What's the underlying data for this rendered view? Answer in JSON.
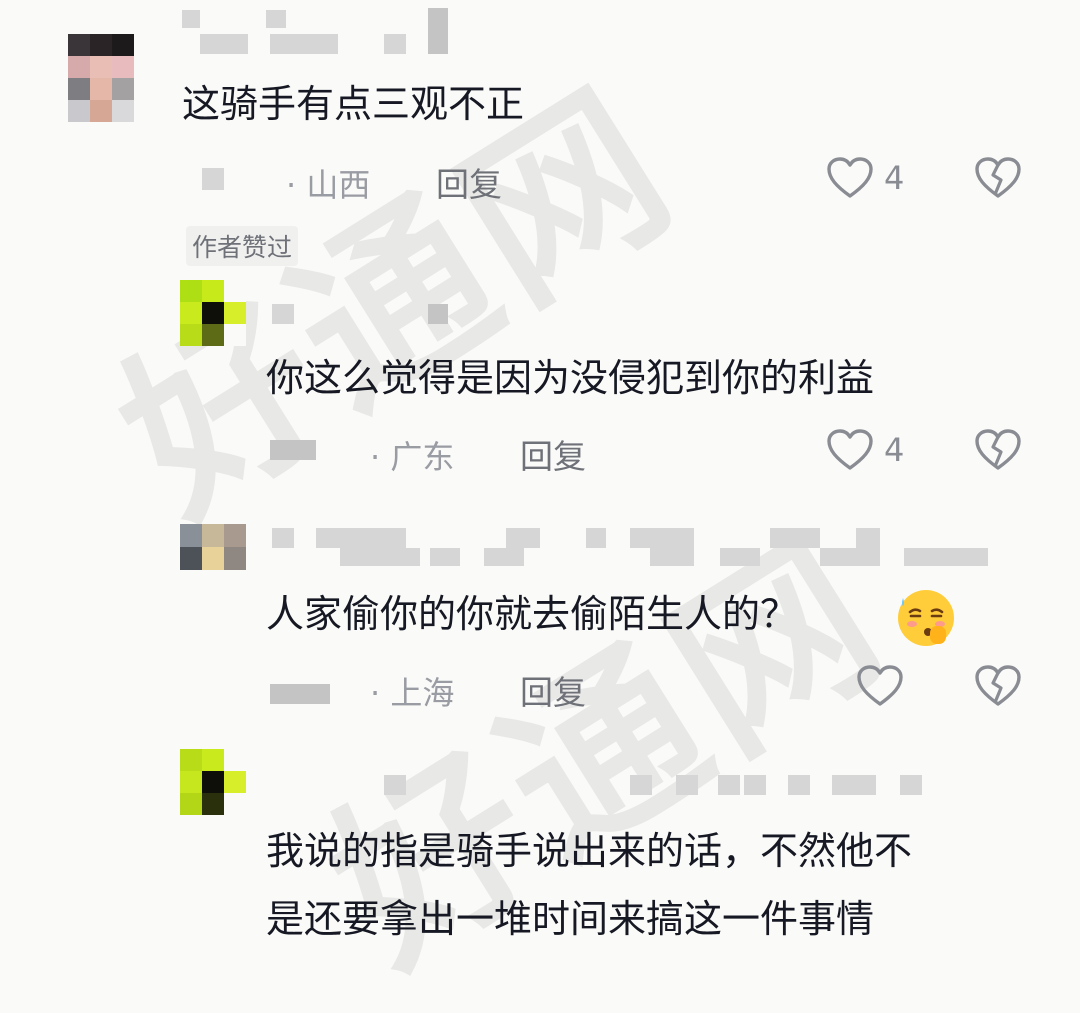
{
  "watermark": "好通网",
  "comments": [
    {
      "text": "这骑手有点三观不正",
      "location": "· 山西",
      "reply_label": "回复",
      "likes": "4",
      "badge": "作者赞过"
    },
    {
      "text": "你这么觉得是因为没侵犯到你的利益",
      "location": "· 广东",
      "reply_label": "回复",
      "likes": "4"
    },
    {
      "text": "人家偷你的你就去偷陌生人的？",
      "location": "· 上海",
      "reply_label": "回复",
      "likes": ""
    },
    {
      "text_line1": "我说的指是骑手说出来的话，不然他不",
      "text_line2": "是还要拿出一堆时间来搞这一件事情"
    }
  ],
  "icons": {
    "like": "heart-outline-icon",
    "dislike": "broken-heart-icon",
    "emoji": "sweat-shy-emoji"
  },
  "colors": {
    "text": "#161823",
    "meta": "#9a9ca3",
    "reply": "#6f7179",
    "icon": "#8a8c93"
  }
}
